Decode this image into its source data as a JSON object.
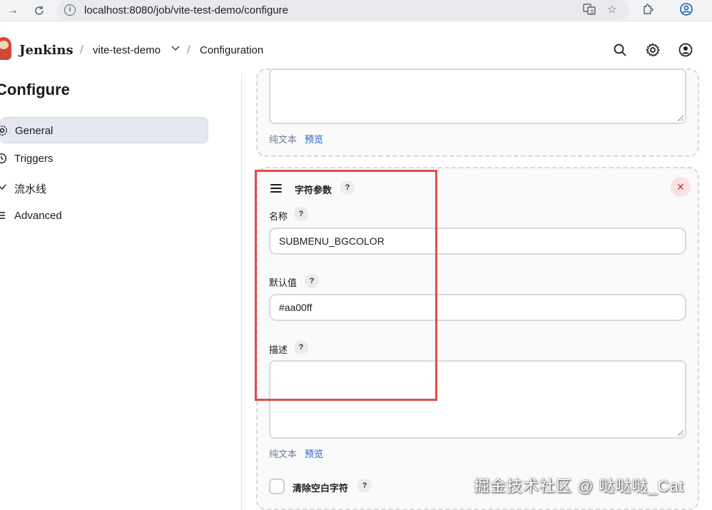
{
  "browser": {
    "url": "localhost:8080/job/vite-test-demo/configure"
  },
  "header": {
    "brand": "Jenkins",
    "breadcrumb": [
      "vite-test-demo",
      "Configuration"
    ]
  },
  "sidebar": {
    "title": "Configure",
    "items": [
      {
        "label": "General",
        "active": true
      },
      {
        "label": "Triggers"
      },
      {
        "label": "流水线"
      },
      {
        "label": "Advanced"
      }
    ]
  },
  "main": {
    "prev_card": {
      "plain_text_link": "纯文本",
      "preview_link": "预览"
    },
    "string_param": {
      "title": "字符参数",
      "help": "?",
      "remove": "✕",
      "name_label": "名称",
      "name_value": "SUBMENU_BGCOLOR",
      "default_label": "默认值",
      "default_value": "#aa00ff",
      "desc_label": "描述",
      "plain_text_link": "纯文本",
      "preview_link": "预览",
      "trim_label": "清除空白字符"
    }
  },
  "colors": {
    "highlight": "#e34b4b",
    "link": "#1660c0"
  },
  "watermark": "掘金技术社区 @ 哒哒哒_Cat"
}
